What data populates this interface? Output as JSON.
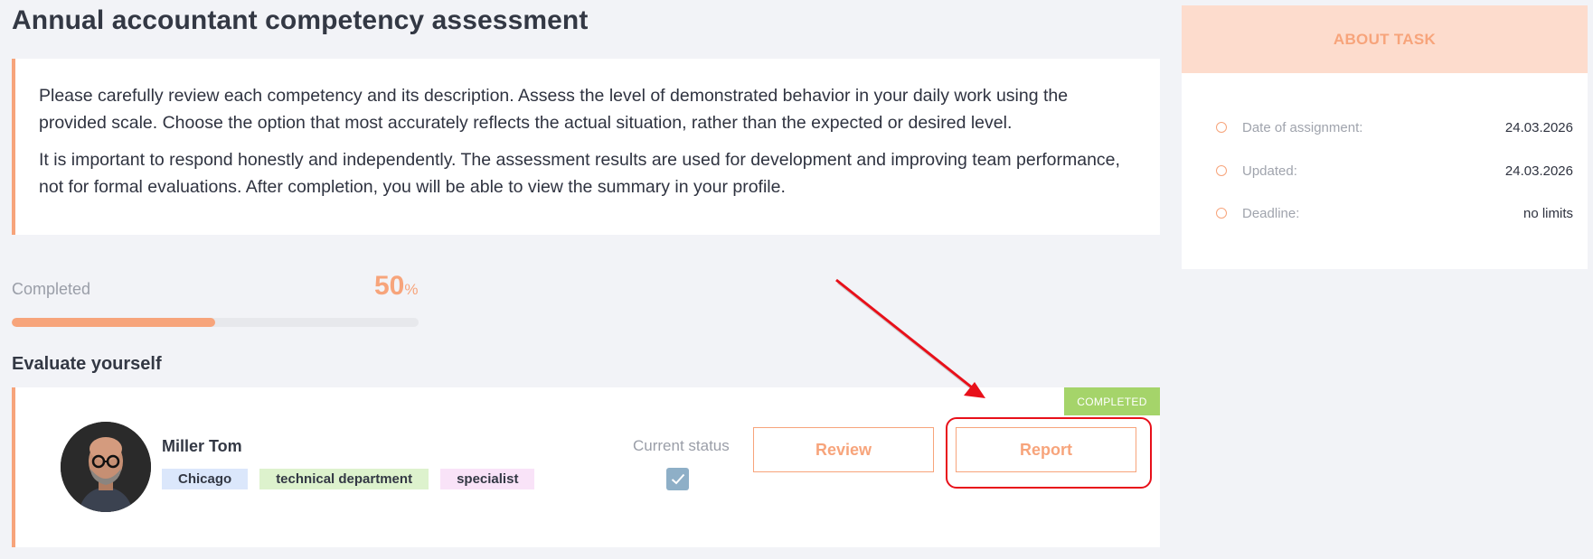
{
  "page": {
    "title": "Annual accountant competency assessment"
  },
  "description": {
    "paragraph1": "Please carefully review each competency and its description. Assess the level of demonstrated behavior in your daily work using the provided scale. Choose the option that most accurately reflects the actual situation, rather than the expected or desired level.",
    "paragraph2": "It is important to respond honestly and independently. The assessment results are used for development and improving team performance, not for formal evaluations. After completion, you will be able to view the summary in your profile."
  },
  "progress": {
    "label": "Completed",
    "value": "50",
    "unit": "%",
    "fraction": 0.5
  },
  "evaluate": {
    "section_title": "Evaluate yourself",
    "badge": "COMPLETED",
    "user_name": "Miller Tom",
    "tags": [
      "Chicago",
      "technical department",
      "specialist"
    ],
    "status_label": "Current status",
    "status_checked": true,
    "review_label": "Review",
    "report_label": "Report"
  },
  "about": {
    "title": "ABOUT TASK",
    "rows": [
      {
        "key": "Date of assignment:",
        "value": "24.03.2026"
      },
      {
        "key": "Updated:",
        "value": "24.03.2026"
      },
      {
        "key": "Deadline:",
        "value": "no limits"
      }
    ]
  },
  "colors": {
    "accent": "#f7a47b",
    "completed_badge": "#a5d46a",
    "highlight": "#e8101a",
    "background": "#f2f3f7"
  },
  "icons": [
    "check-icon",
    "bullet-circle-icon",
    "arrow-annotation"
  ]
}
